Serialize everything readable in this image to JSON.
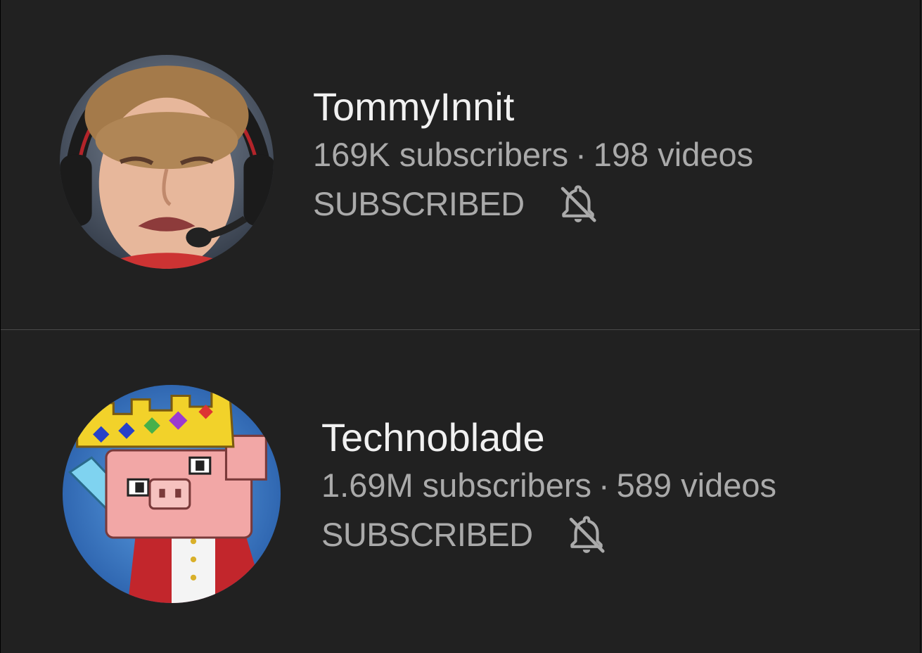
{
  "channels": [
    {
      "name": "TommyInnit",
      "subscribers": "169K subscribers",
      "separator": "·",
      "videos": "198 videos",
      "subscribe_state": "SUBSCRIBED",
      "notification_icon": "bell-off-icon",
      "avatar_icon": "avatar-photo"
    },
    {
      "name": "Technoblade",
      "subscribers": "1.69M subscribers",
      "separator": "·",
      "videos": "589 videos",
      "subscribe_state": "SUBSCRIBED",
      "notification_icon": "bell-off-icon",
      "avatar_icon": "avatar-cartoon-pig-king"
    }
  ],
  "colors": {
    "background": "#212121",
    "title_text": "#f1f1f1",
    "secondary_text": "#aaaaaa",
    "divider": "#4a4a4a"
  }
}
